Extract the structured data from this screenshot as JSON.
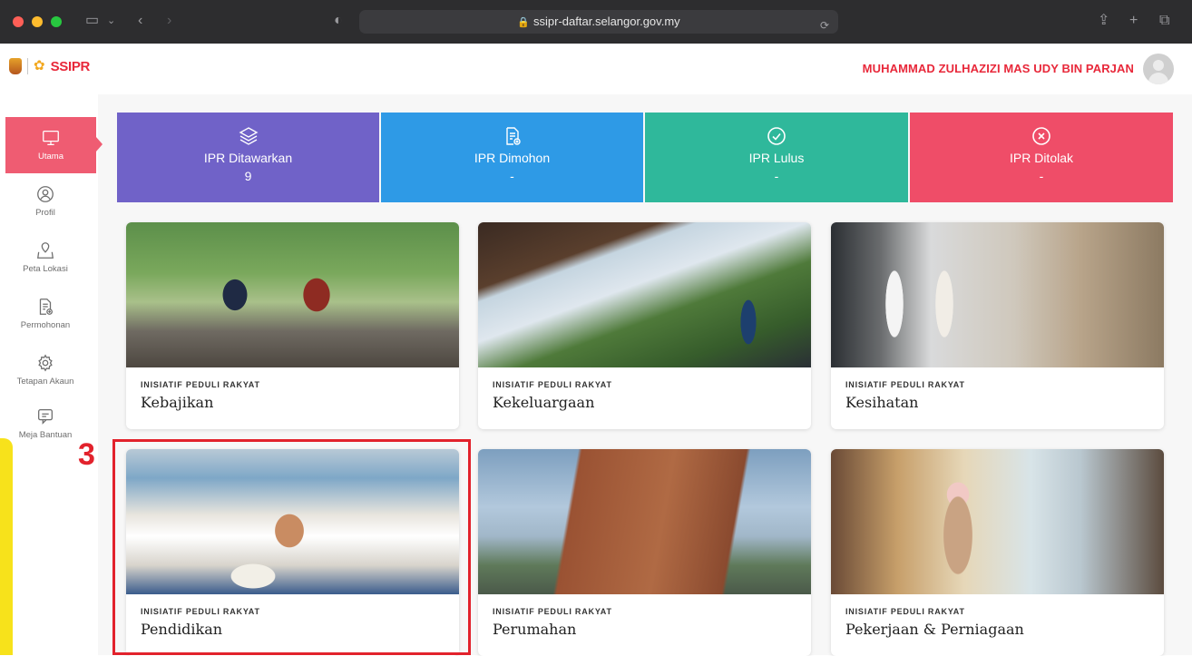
{
  "browser": {
    "url": "ssipr-daftar.selangor.gov.my"
  },
  "header": {
    "logo_text": "SSIPR",
    "user_name": "MUHAMMAD ZULHAZIZI MAS UDY BIN PARJAN"
  },
  "sidebar": {
    "items": [
      {
        "label": "Utama",
        "icon": "monitor-icon",
        "active": true
      },
      {
        "label": "Profil",
        "icon": "user-icon"
      },
      {
        "label": "Peta Lokasi",
        "icon": "map-icon"
      },
      {
        "label": "Permohonan",
        "icon": "document-add-icon"
      },
      {
        "label": "Tetapan Akaun",
        "icon": "gear-icon"
      },
      {
        "label": "Meja Bantuan",
        "icon": "chat-icon"
      }
    ]
  },
  "stats": [
    {
      "label": "IPR Ditawarkan",
      "value": "9",
      "icon": "layers-icon",
      "color": "#7062c8"
    },
    {
      "label": "IPR Dimohon",
      "value": "-",
      "icon": "document-add-icon",
      "color": "#2e9ae6"
    },
    {
      "label": "IPR Lulus",
      "value": "-",
      "icon": "check-circle-icon",
      "color": "#2fb89b"
    },
    {
      "label": "IPR Ditolak",
      "value": "-",
      "icon": "x-circle-icon",
      "color": "#ef4d68"
    }
  ],
  "cards": [
    {
      "kicker": "INISIATIF PEDULI RAKYAT",
      "title": "Kebajikan"
    },
    {
      "kicker": "INISIATIF PEDULI RAKYAT",
      "title": "Kekeluargaan"
    },
    {
      "kicker": "INISIATIF PEDULI RAKYAT",
      "title": "Kesihatan"
    },
    {
      "kicker": "INISIATIF PEDULI RAKYAT",
      "title": "Pendidikan"
    },
    {
      "kicker": "INISIATIF PEDULI RAKYAT",
      "title": "Perumahan"
    },
    {
      "kicker": "INISIATIF PEDULI RAKYAT",
      "title": "Pekerjaan & Perniagaan"
    }
  ],
  "annotation": {
    "step_number": "3",
    "color": "#e2222c"
  }
}
